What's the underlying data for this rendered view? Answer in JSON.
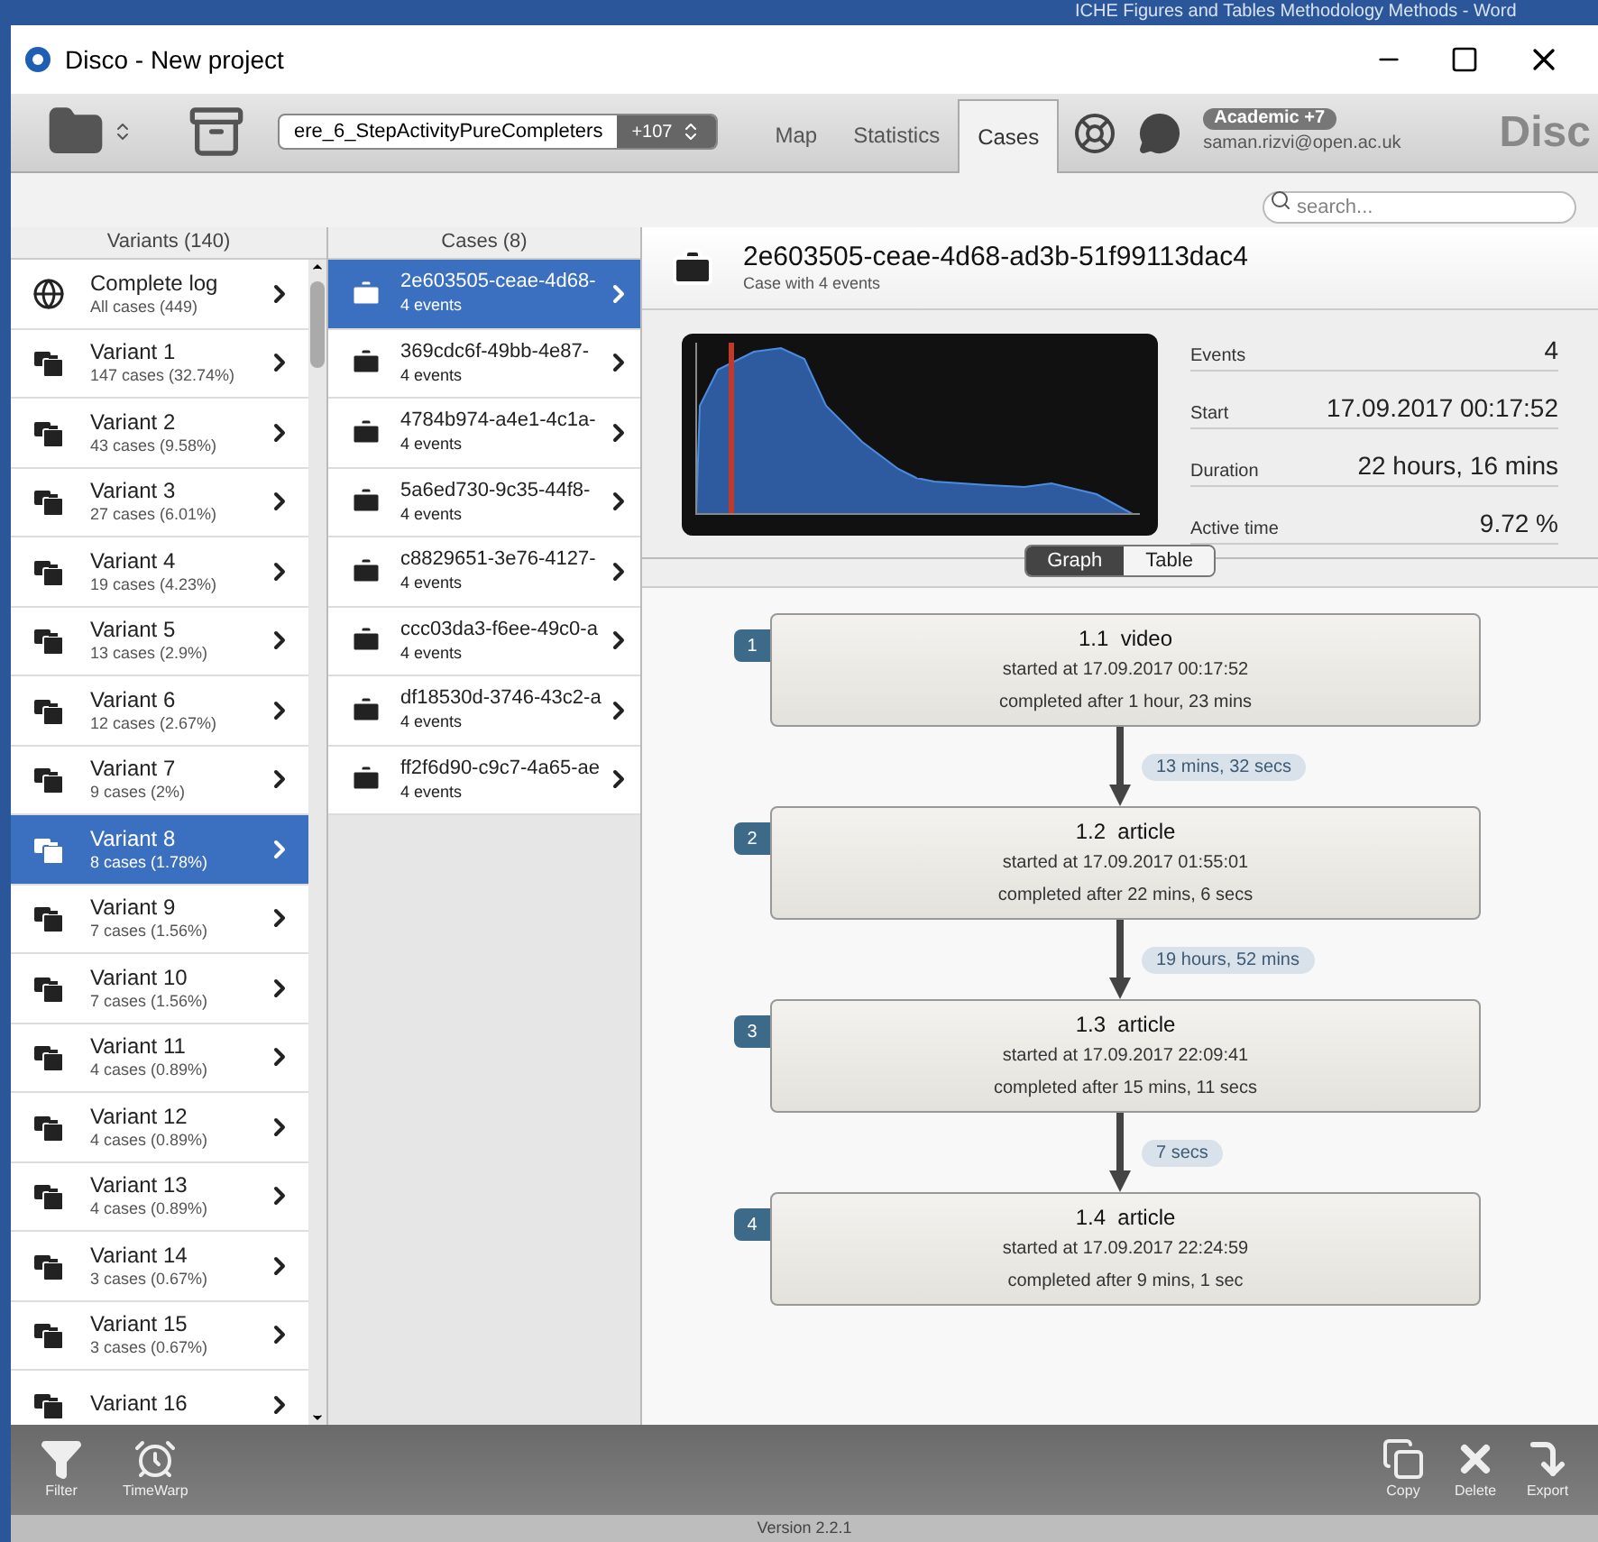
{
  "background_window": {
    "title": "ICHE Figures and Tables Methodology Methods  -  Word"
  },
  "window": {
    "title": "Disco - New project"
  },
  "toolbar": {
    "dataset": "ere_6_StepActivityPureCompleters",
    "dataset_count": "+107",
    "tabs": [
      {
        "label": "Map",
        "selected": false
      },
      {
        "label": "Statistics",
        "selected": false
      },
      {
        "label": "Cases",
        "selected": true
      }
    ],
    "account": {
      "badge": "Academic +7",
      "email": "saman.rizvi@open.ac.uk"
    },
    "logo": "Disc"
  },
  "search": {
    "placeholder": "search..."
  },
  "variants": {
    "header": "Variants (140)",
    "items": [
      {
        "kind": "log",
        "name": "Complete log",
        "sub": "All cases (449)",
        "selected": false
      },
      {
        "kind": "variant",
        "name": "Variant 1",
        "sub": "147 cases (32.74%)",
        "selected": false
      },
      {
        "kind": "variant",
        "name": "Variant 2",
        "sub": "43 cases (9.58%)",
        "selected": false
      },
      {
        "kind": "variant",
        "name": "Variant 3",
        "sub": "27 cases (6.01%)",
        "selected": false
      },
      {
        "kind": "variant",
        "name": "Variant 4",
        "sub": "19 cases (4.23%)",
        "selected": false
      },
      {
        "kind": "variant",
        "name": "Variant 5",
        "sub": "13 cases (2.9%)",
        "selected": false
      },
      {
        "kind": "variant",
        "name": "Variant 6",
        "sub": "12 cases (2.67%)",
        "selected": false
      },
      {
        "kind": "variant",
        "name": "Variant 7",
        "sub": "9 cases (2%)",
        "selected": false
      },
      {
        "kind": "variant",
        "name": "Variant 8",
        "sub": "8 cases (1.78%)",
        "selected": true
      },
      {
        "kind": "variant",
        "name": "Variant 9",
        "sub": "7 cases (1.56%)",
        "selected": false
      },
      {
        "kind": "variant",
        "name": "Variant 10",
        "sub": "7 cases (1.56%)",
        "selected": false
      },
      {
        "kind": "variant",
        "name": "Variant 11",
        "sub": "4 cases (0.89%)",
        "selected": false
      },
      {
        "kind": "variant",
        "name": "Variant 12",
        "sub": "4 cases (0.89%)",
        "selected": false
      },
      {
        "kind": "variant",
        "name": "Variant 13",
        "sub": "4 cases (0.89%)",
        "selected": false
      },
      {
        "kind": "variant",
        "name": "Variant 14",
        "sub": "3 cases (0.67%)",
        "selected": false
      },
      {
        "kind": "variant",
        "name": "Variant 15",
        "sub": "3 cases (0.67%)",
        "selected": false
      },
      {
        "kind": "variant",
        "name": "Variant 16",
        "selected": false
      }
    ]
  },
  "cases": {
    "header": "Cases (8)",
    "items": [
      {
        "id": "2e603505-ceae-4d68-",
        "sub": "4 events",
        "selected": true
      },
      {
        "id": "369cdc6f-49bb-4e87-",
        "sub": "4 events",
        "selected": false
      },
      {
        "id": "4784b974-a4e1-4c1a-",
        "sub": "4 events",
        "selected": false
      },
      {
        "id": "5a6ed730-9c35-44f8-",
        "sub": "4 events",
        "selected": false
      },
      {
        "id": "c8829651-3e76-4127-",
        "sub": "4 events",
        "selected": false
      },
      {
        "id": "ccc03da3-f6ee-49c0-a",
        "sub": "4 events",
        "selected": false
      },
      {
        "id": "df18530d-3746-43c2-a",
        "sub": "4 events",
        "selected": false
      },
      {
        "id": "ff2f6d90-c9c7-4a65-ae",
        "sub": "4 events",
        "selected": false
      }
    ]
  },
  "case_detail": {
    "title": "2e603505-ceae-4d68-ad3b-51f99113dac4",
    "subtitle": "Case with 4 events",
    "stats": [
      {
        "label": "Events",
        "value": "4"
      },
      {
        "label": "Start",
        "value": "17.09.2017 00:17:52"
      },
      {
        "label": "Duration",
        "value": "22 hours, 16 mins"
      },
      {
        "label": "Active time",
        "value": "9.72 %"
      }
    ],
    "view_toggle": [
      {
        "label": "Graph",
        "selected": true
      },
      {
        "label": "Table",
        "selected": false
      }
    ],
    "events": [
      {
        "index": "1",
        "title": "1.1  video",
        "started": "started at 17.09.2017 00:17:52",
        "completed": "completed after 1 hour, 23 mins",
        "gap": "13 mins, 32 secs"
      },
      {
        "index": "2",
        "title": "1.2  article",
        "started": "started at 17.09.2017 01:55:01",
        "completed": "completed after 22 mins, 6 secs",
        "gap": "19 hours, 52 mins"
      },
      {
        "index": "3",
        "title": "1.3  article",
        "started": "started at 17.09.2017 22:09:41",
        "completed": "completed after 15 mins, 11 secs",
        "gap": "7 secs"
      },
      {
        "index": "4",
        "title": "1.4  article",
        "started": "started at 17.09.2017 22:24:59",
        "completed": "completed after 9 mins, 1 sec"
      }
    ]
  },
  "bottom_toolbar": {
    "left": [
      {
        "kind": "filter",
        "label": "Filter"
      },
      {
        "kind": "timewarp",
        "label": "TimeWarp"
      }
    ],
    "right": [
      {
        "kind": "copy",
        "label": "Copy"
      },
      {
        "kind": "delete",
        "label": "Delete"
      },
      {
        "kind": "export",
        "label": "Export"
      }
    ]
  },
  "status_bar": {
    "version": "Version 2.2.1"
  }
}
